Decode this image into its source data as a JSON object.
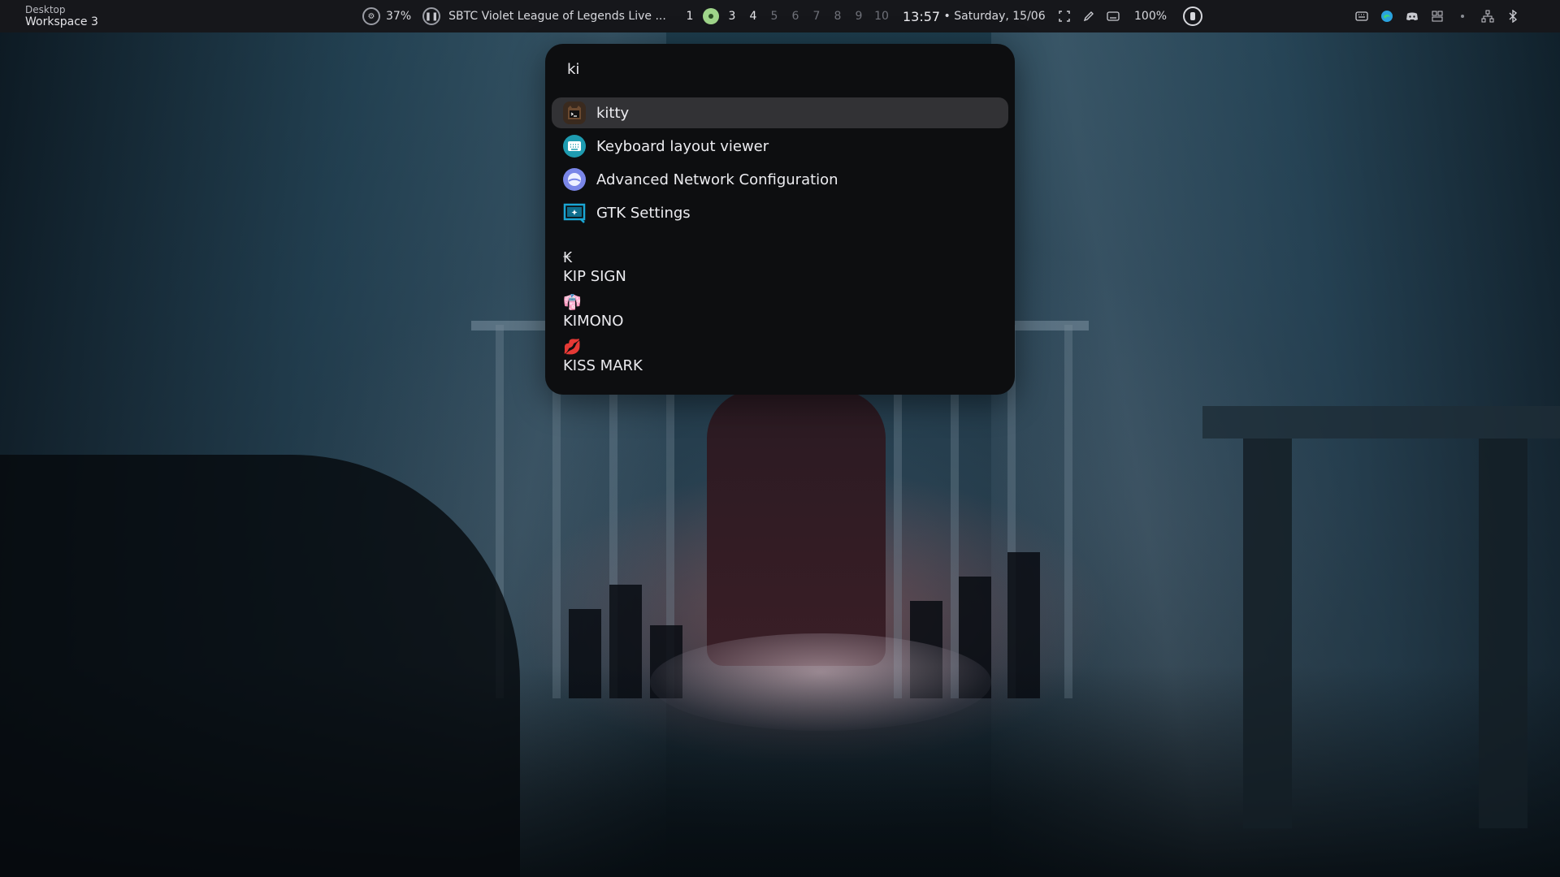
{
  "topbar": {
    "workspace_label_small": "Desktop",
    "workspace_label": "Workspace 3",
    "cpu_icon": "gear-ring-icon",
    "cpu_value": "37%",
    "media_icon": "pause-ring-icon",
    "media_title": "SBTC Violet League of Legends Live ...",
    "workspaces": [
      {
        "label": "1",
        "state": "occupied"
      },
      {
        "label": "",
        "state": "active"
      },
      {
        "label": "3",
        "state": "occupied"
      },
      {
        "label": "4",
        "state": "occupied"
      },
      {
        "label": "5",
        "state": "empty"
      },
      {
        "label": "6",
        "state": "empty"
      },
      {
        "label": "7",
        "state": "empty"
      },
      {
        "label": "8",
        "state": "empty"
      },
      {
        "label": "9",
        "state": "empty"
      },
      {
        "label": "10",
        "state": "empty"
      }
    ],
    "time": "13:57",
    "date": " • Saturday, 15/06",
    "battery_value": "100%",
    "tray_icons": [
      "keyboard-icon",
      "edge-icon",
      "discord-icon",
      "dashboard-icon",
      "dot-icon",
      "network-icon",
      "bluetooth-icon"
    ]
  },
  "launcher": {
    "search_value": "ki",
    "apps": [
      {
        "label": "kitty",
        "icon": "kitty-icon",
        "color": "#3a2a1e",
        "selected": true
      },
      {
        "label": "Keyboard layout viewer",
        "icon": "keyboard-icon",
        "color": "#1e9bb0"
      },
      {
        "label": "Advanced Network Configuration",
        "icon": "network-config-icon",
        "color": "#7a86e8"
      },
      {
        "label": "GTK Settings",
        "icon": "gtk-settings-icon",
        "color": "#1aa6d4"
      }
    ],
    "emojis": [
      {
        "glyph": "₭",
        "name": "KIP SIGN"
      },
      {
        "glyph": "👘",
        "name": "KIMONO"
      },
      {
        "glyph": "💋",
        "name": "KISS MARK"
      }
    ]
  }
}
